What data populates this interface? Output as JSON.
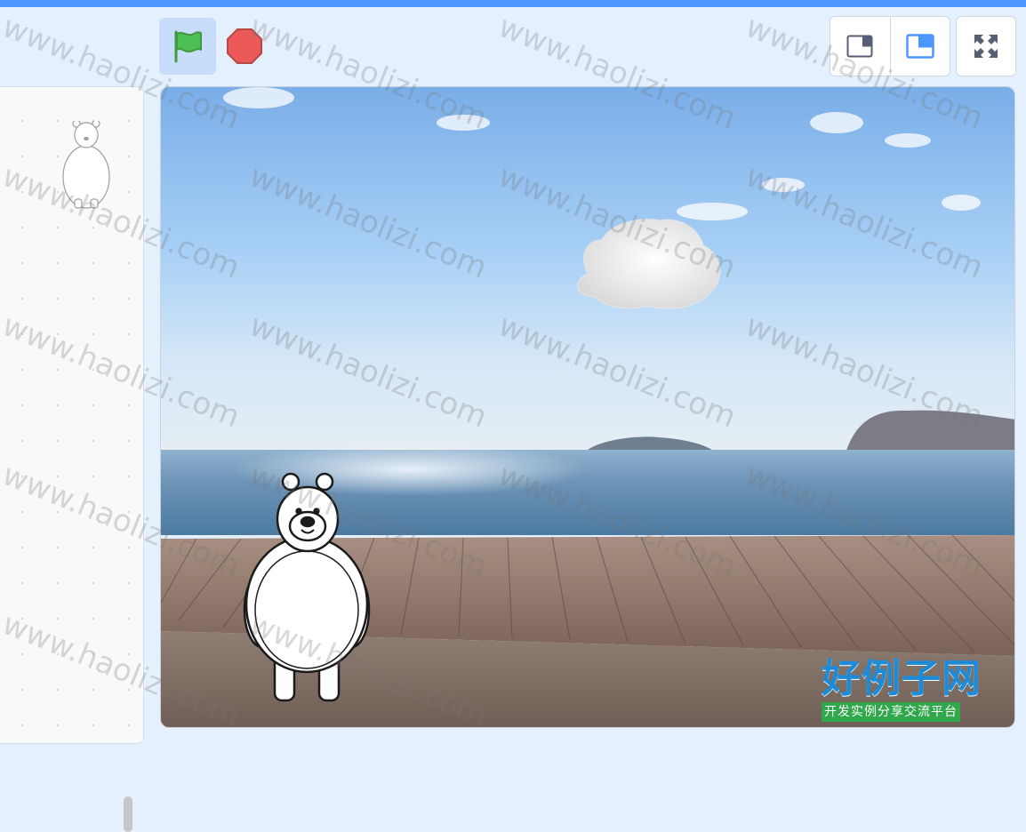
{
  "toolbar": {
    "green_flag_icon": "green-flag-icon",
    "stop_icon": "stop-sign-icon",
    "small_stage_icon": "small-stage-layout-icon",
    "normal_stage_icon": "normal-stage-layout-icon",
    "fullscreen_icon": "fullscreen-icon"
  },
  "colors": {
    "accent": "#4c97ff",
    "flag_green": "#4cbf56",
    "stop_red": "#ec5959",
    "background": "#e5f0ff"
  },
  "stage": {
    "backdrop": "beach boardwalk",
    "sprites": [
      "polar-bear",
      "snow-cloud"
    ]
  },
  "watermark": {
    "text": "www.haolizi.com",
    "logo_main": "好例子网",
    "logo_sub": "开发实例分享交流平台"
  }
}
